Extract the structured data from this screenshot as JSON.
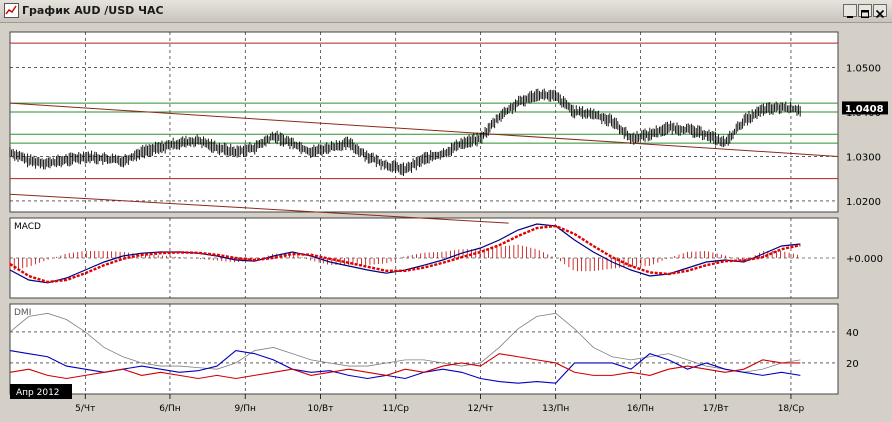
{
  "window": {
    "title": "График AUD /USD  ЧАС",
    "icons": {
      "app": "chart-app-icon",
      "minimize": "minimize-icon",
      "maximize": "maximize-icon",
      "close": "close-icon"
    }
  },
  "colors": {
    "background": "#ffffff",
    "grid": "#000000",
    "price": "#000000",
    "resistance_line": "#b02020",
    "support_line": "#2f8f2f",
    "trend_line": "#8b2a18",
    "macd_line": "#000080",
    "signal_line": "#e00000",
    "histogram": "#c00000",
    "dmi_adx": "#808080",
    "dmi_plus": "#0000c0",
    "dmi_minus": "#d00000"
  },
  "chart_data": [
    {
      "type": "line",
      "title": "",
      "panel": "price",
      "ylim": [
        1.0175,
        1.058
      ],
      "y_ticks": [
        "1.0500",
        "1.0400",
        "1.0300",
        "1.0200"
      ],
      "current_price": "1.0408",
      "horizontal_levels": {
        "resistance": [
          1.0555,
          1.025
        ],
        "support": [
          1.042,
          1.04,
          1.035,
          1.033
        ]
      },
      "trend_lines": [
        {
          "x": [
            0,
            88
          ],
          "y": [
            1.042,
            1.03
          ]
        },
        {
          "x": [
            0,
            53
          ],
          "y": [
            1.0215,
            1.015
          ]
        }
      ],
      "x": [
        0,
        2,
        4,
        6,
        8,
        10,
        12,
        14,
        16,
        18,
        20,
        22,
        24,
        26,
        28,
        30,
        32,
        34,
        36,
        38,
        40,
        42,
        44,
        46,
        48,
        50,
        52,
        54,
        56,
        58,
        60,
        62,
        64,
        66,
        68,
        70,
        72,
        74,
        76,
        78,
        80,
        82,
        84
      ],
      "values": [
        1.031,
        1.029,
        1.0285,
        1.0292,
        1.03,
        1.0295,
        1.029,
        1.031,
        1.032,
        1.033,
        1.0335,
        1.032,
        1.031,
        1.032,
        1.0345,
        1.033,
        1.031,
        1.032,
        1.033,
        1.03,
        1.028,
        1.027,
        1.0295,
        1.0305,
        1.033,
        1.034,
        1.039,
        1.042,
        1.044,
        1.0435,
        1.04,
        1.0395,
        1.038,
        1.034,
        1.035,
        1.0365,
        1.036,
        1.035,
        1.033,
        1.038,
        1.0405,
        1.041,
        1.0405
      ]
    },
    {
      "type": "line",
      "title": "",
      "panel": "macd",
      "legend": "MACD",
      "y_ticks": [
        "+0.000"
      ],
      "ylim": [
        -1.0,
        1.0
      ],
      "x": [
        0,
        2,
        4,
        6,
        8,
        10,
        12,
        14,
        16,
        18,
        20,
        22,
        24,
        26,
        28,
        30,
        32,
        34,
        36,
        38,
        40,
        42,
        44,
        46,
        48,
        50,
        52,
        54,
        56,
        58,
        60,
        62,
        64,
        66,
        68,
        70,
        72,
        74,
        76,
        78,
        80,
        82,
        84
      ],
      "series": [
        {
          "values": [
            -0.3,
            -0.55,
            -0.62,
            -0.5,
            -0.3,
            -0.1,
            0.05,
            0.12,
            0.15,
            0.15,
            0.12,
            0.05,
            -0.05,
            -0.08,
            0.05,
            0.15,
            0.05,
            -0.1,
            -0.2,
            -0.3,
            -0.38,
            -0.3,
            -0.18,
            -0.05,
            0.12,
            0.25,
            0.45,
            0.7,
            0.85,
            0.8,
            0.45,
            0.15,
            -0.1,
            -0.3,
            -0.45,
            -0.4,
            -0.25,
            -0.1,
            -0.05,
            -0.1,
            0.1,
            0.3,
            0.35
          ]
        },
        {
          "values": [
            -0.15,
            -0.45,
            -0.6,
            -0.55,
            -0.38,
            -0.18,
            -0.02,
            0.08,
            0.12,
            0.14,
            0.13,
            0.08,
            0.0,
            -0.05,
            0.0,
            0.1,
            0.08,
            -0.02,
            -0.12,
            -0.22,
            -0.32,
            -0.32,
            -0.24,
            -0.12,
            0.02,
            0.15,
            0.32,
            0.55,
            0.75,
            0.8,
            0.6,
            0.3,
            0.02,
            -0.2,
            -0.36,
            -0.4,
            -0.32,
            -0.18,
            -0.08,
            -0.06,
            0.02,
            0.22,
            0.32
          ]
        }
      ]
    },
    {
      "type": "line",
      "title": "",
      "panel": "dmi",
      "legend": "DMI",
      "y_ticks": [
        "40",
        "20"
      ],
      "ylim": [
        0,
        58
      ],
      "x_ticks": [
        "5/Чт",
        "6/Пн",
        "9/Пн",
        "10/Вт",
        "11/Ср",
        "12/Чт",
        "13/Пн",
        "16/Пн",
        "17/Вт",
        "18/Ср"
      ],
      "x_tick_positions": [
        8,
        17,
        25,
        33,
        41,
        50,
        58,
        67,
        75,
        83
      ],
      "date_label": "Апр 2012",
      "x": [
        0,
        2,
        4,
        6,
        8,
        10,
        12,
        14,
        16,
        18,
        20,
        22,
        24,
        26,
        28,
        30,
        32,
        34,
        36,
        38,
        40,
        42,
        44,
        46,
        48,
        50,
        52,
        54,
        56,
        58,
        60,
        62,
        64,
        66,
        68,
        70,
        72,
        74,
        76,
        78,
        80,
        82,
        84
      ],
      "series": [
        {
          "values": [
            40,
            50,
            52,
            48,
            40,
            30,
            24,
            20,
            18,
            18,
            17,
            16,
            20,
            28,
            30,
            26,
            22,
            20,
            18,
            18,
            20,
            22,
            22,
            20,
            18,
            20,
            30,
            42,
            50,
            52,
            42,
            30,
            24,
            22,
            24,
            26,
            22,
            18,
            16,
            14,
            16,
            20,
            22
          ]
        },
        {
          "values": [
            28,
            26,
            24,
            18,
            16,
            14,
            16,
            18,
            16,
            14,
            15,
            18,
            28,
            26,
            22,
            16,
            14,
            15,
            12,
            10,
            12,
            10,
            14,
            16,
            14,
            10,
            8,
            7,
            8,
            7,
            20,
            20,
            20,
            16,
            26,
            22,
            16,
            20,
            16,
            14,
            12,
            14,
            12
          ]
        },
        {
          "values": [
            14,
            16,
            12,
            10,
            12,
            14,
            16,
            12,
            14,
            12,
            10,
            12,
            10,
            12,
            14,
            16,
            12,
            14,
            16,
            14,
            12,
            16,
            14,
            18,
            20,
            18,
            26,
            24,
            22,
            20,
            14,
            12,
            12,
            14,
            12,
            16,
            18,
            16,
            14,
            16,
            22,
            20,
            20
          ]
        }
      ]
    }
  ]
}
